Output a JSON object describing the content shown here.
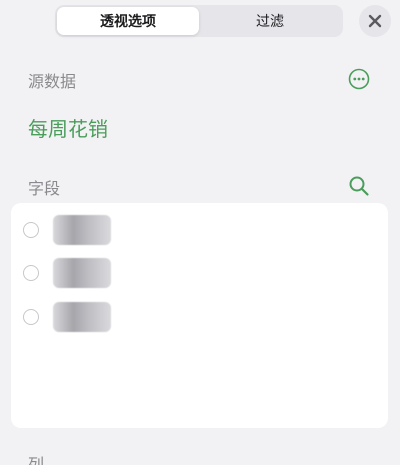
{
  "tabs": [
    {
      "label": "透视选项",
      "active": true
    },
    {
      "label": "过滤",
      "active": false
    }
  ],
  "source": {
    "label": "源数据",
    "name": "每周花销"
  },
  "fields": {
    "label": "字段",
    "items": [
      {
        "label": "",
        "selected": false
      },
      {
        "label": "",
        "selected": false
      },
      {
        "label": "",
        "selected": false
      }
    ]
  },
  "bottom_section": {
    "label": "列"
  },
  "icons": {
    "close": "close-icon",
    "more": "more-icon",
    "search": "search-icon"
  },
  "colors": {
    "accent": "#4a9d5b",
    "background": "#f2f2f4",
    "card": "#ffffff"
  }
}
